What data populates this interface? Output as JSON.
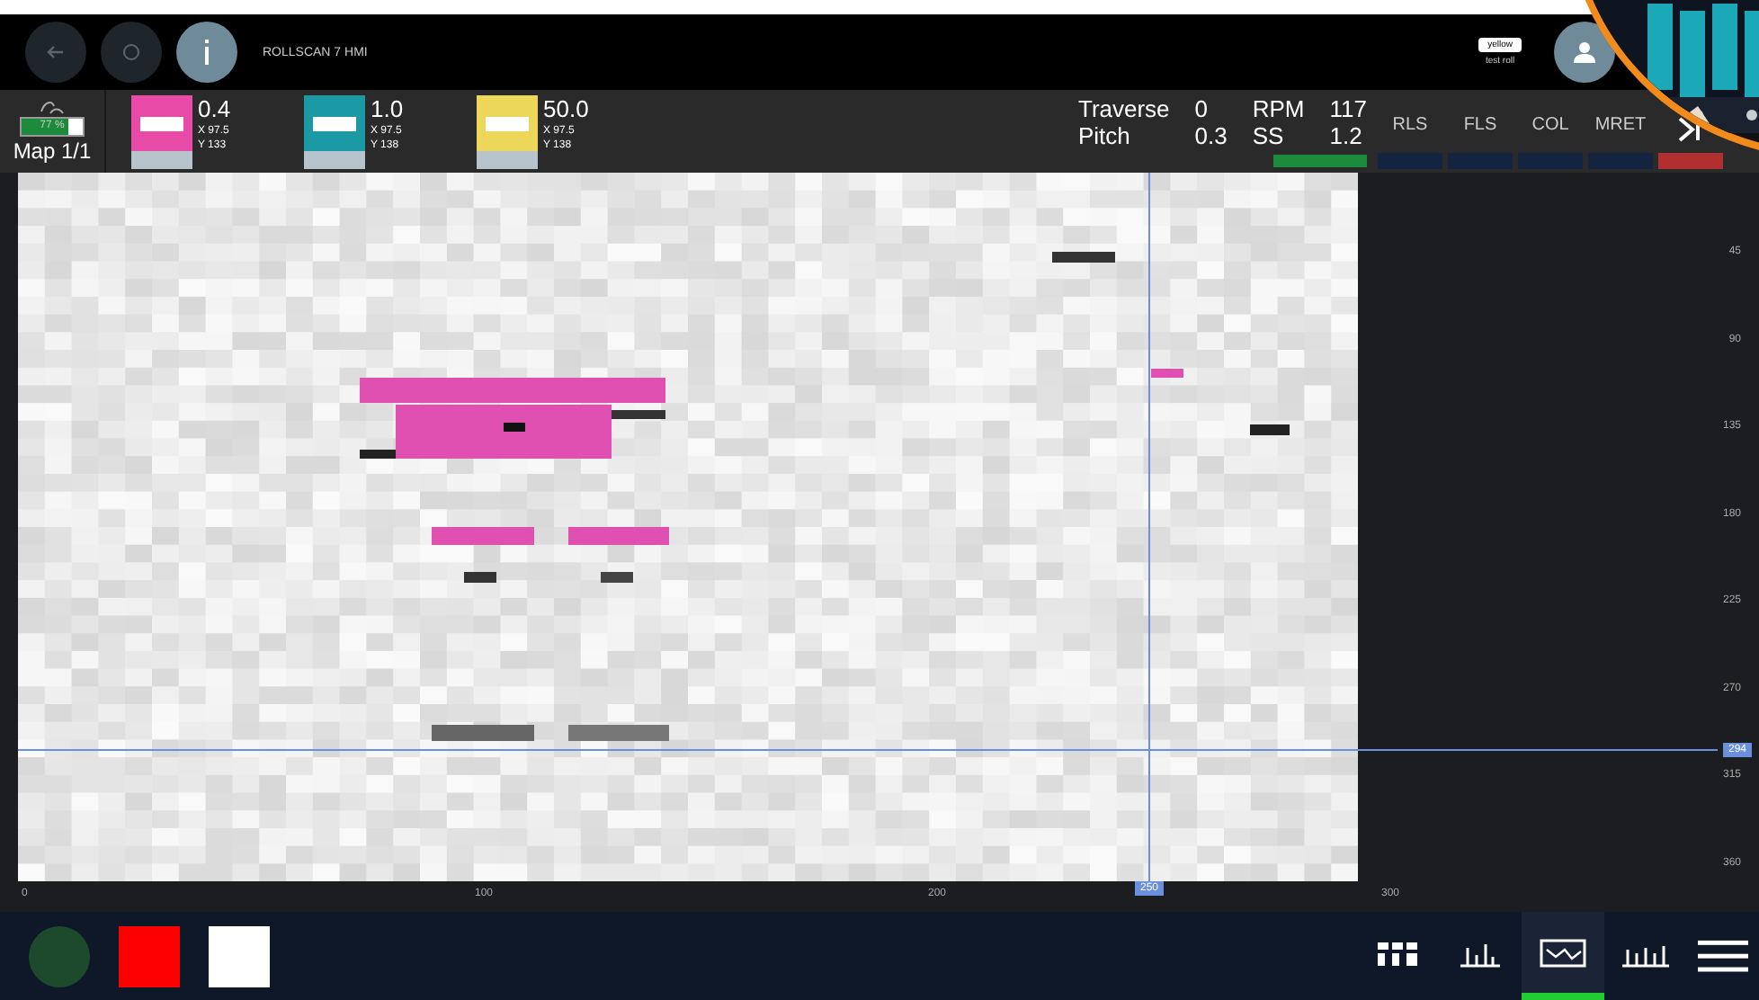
{
  "header": {
    "title": "ROLLSCAN 7 HMI",
    "user_tag": "yellow",
    "user_roll": "test roll"
  },
  "map_status": {
    "level": 0.77,
    "percent": "77 %",
    "label": "Map 1/1"
  },
  "tools": [
    {
      "color": "#e84aa8",
      "value": "0.4",
      "x": "X 97.5",
      "y": "Y 133"
    },
    {
      "color": "#1b9aa6",
      "value": "1.0",
      "x": "X 97.5",
      "y": "Y 138"
    },
    {
      "color": "#ecd75a",
      "value": "50.0",
      "x": "X 97.5",
      "y": "Y 138"
    }
  ],
  "readings": [
    {
      "label": "Traverse",
      "value": "0"
    },
    {
      "label": "Pitch",
      "value": "0.3"
    },
    {
      "label": "RPM",
      "value": "117"
    },
    {
      "label": "SS",
      "value": "1.2"
    }
  ],
  "indicators": [
    {
      "label": "RLS",
      "color": "#142340"
    },
    {
      "label": "FLS",
      "color": "#142340"
    },
    {
      "label": "COL",
      "color": "#142340"
    },
    {
      "label": "MRET",
      "color": "#142340"
    }
  ],
  "y_ticks": [
    "45",
    "90",
    "135",
    "180",
    "225",
    "270",
    "315",
    "360"
  ],
  "y_cursor": "294",
  "x_ticks": [
    "0",
    "100",
    "200",
    "300"
  ],
  "x_cursor": "250",
  "swatches": [
    {
      "kind": "circle",
      "color": "#1d4a2c"
    },
    {
      "kind": "square",
      "color": "#ff0000"
    },
    {
      "kind": "square",
      "color": "#ffffff"
    }
  ],
  "views": [
    {
      "kind": "map",
      "selected": false
    },
    {
      "kind": "bars",
      "selected": false
    },
    {
      "kind": "trend",
      "selected": true
    },
    {
      "kind": "histogram",
      "selected": false
    }
  ]
}
